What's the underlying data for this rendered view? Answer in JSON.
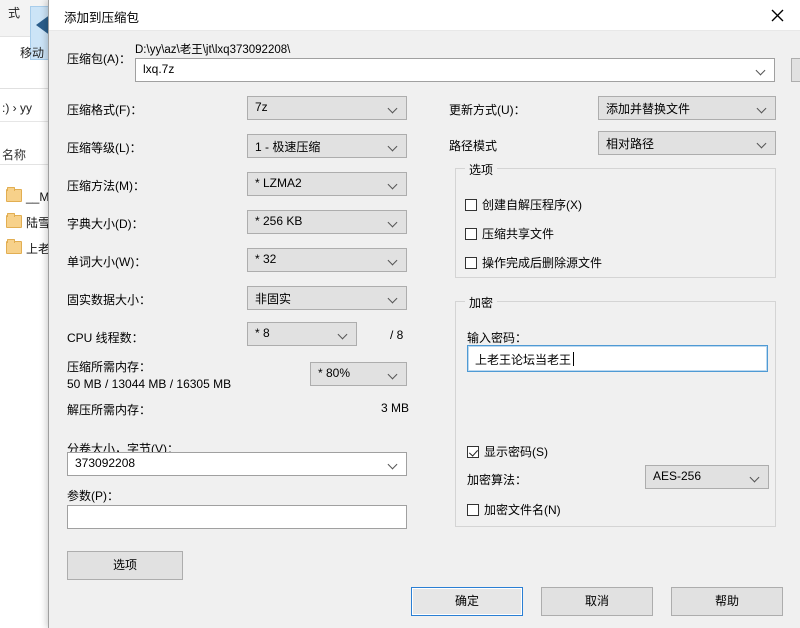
{
  "background": {
    "ribbon_tab": "式",
    "move_button_label": "移动",
    "address_text": ":) › yy",
    "column_header": "名称",
    "rows": [
      {
        "label": "__MA"
      },
      {
        "label": "陆雪玥"
      },
      {
        "label": "上老王"
      }
    ]
  },
  "dialog": {
    "title": "添加到压缩包",
    "close_icon": "close-icon"
  },
  "archive": {
    "label": "压缩包(A)：",
    "path": "D:\\yy\\az\\老王\\jt\\lxq373092208\\",
    "name": "lxq.7z",
    "browse_label": "..."
  },
  "left_fields": {
    "format": {
      "label": "压缩格式(F)：",
      "value": "7z"
    },
    "level": {
      "label": "压缩等级(L)：",
      "value": "1 - 极速压缩"
    },
    "method": {
      "label": "压缩方法(M)：",
      "value": "* LZMA2"
    },
    "dictionary": {
      "label": "字典大小(D)：",
      "value": "* 256 KB"
    },
    "word_size": {
      "label": "单词大小(W)：",
      "value": "* 32"
    },
    "solid_block": {
      "label": "固实数据大小：",
      "value": "非固实"
    },
    "cpu_threads": {
      "label": "CPU 线程数：",
      "value": "* 8",
      "total": "/ 8"
    },
    "mem_compress": {
      "label": "压缩所需内存：",
      "detail": "50 MB / 13044 MB / 16305 MB",
      "percent": "* 80%"
    },
    "mem_decompress": {
      "label": "解压所需内存：",
      "value": "3 MB"
    },
    "split_size": {
      "label": "分卷大小，字节(V)：",
      "value": "373092208"
    },
    "parameters": {
      "label": "参数(P)：",
      "value": ""
    }
  },
  "right_fields": {
    "update_mode": {
      "label": "更新方式(U)：",
      "value": "添加并替换文件"
    },
    "path_mode": {
      "label": "路径模式",
      "value": "相对路径"
    },
    "options_group": {
      "title": "选项",
      "checkboxes": [
        {
          "label": "创建自解压程序(X)",
          "checked": false
        },
        {
          "label": "压缩共享文件",
          "checked": false
        },
        {
          "label": "操作完成后删除源文件",
          "checked": false
        }
      ]
    },
    "encryption_group": {
      "title": "加密",
      "password_label": "输入密码：",
      "password_value": "上老王论坛当老王",
      "show_password": {
        "label": "显示密码(S)",
        "checked": true
      },
      "algorithm_label": "加密算法：",
      "algorithm_value": "AES-256",
      "encrypt_filenames": {
        "label": "加密文件名(N)",
        "checked": false
      }
    }
  },
  "buttons": {
    "options": "选项",
    "ok": "确定",
    "cancel": "取消",
    "help": "帮助"
  },
  "colors": {
    "dialog_bg": "#f0f0f0",
    "combo_bg": "#e1e1e1",
    "focus_blue": "#4f9ad4",
    "default_btn_blue": "#2a7fd4"
  }
}
